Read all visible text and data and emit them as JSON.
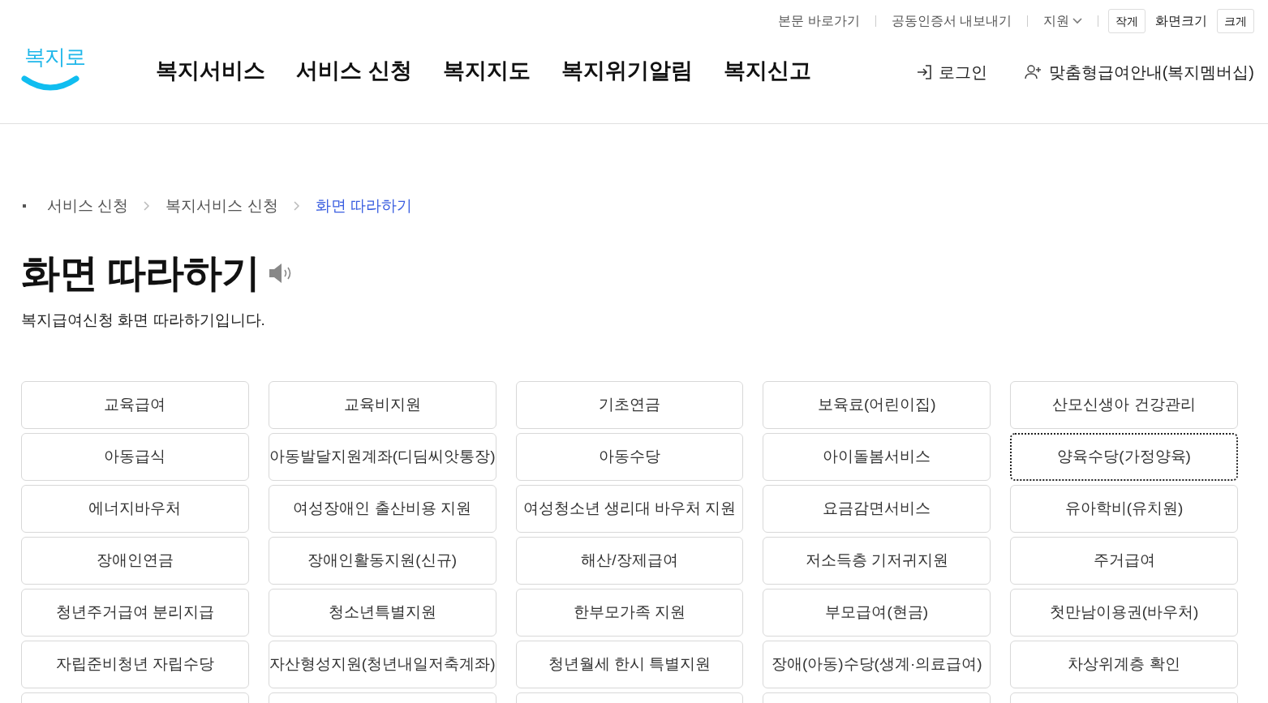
{
  "utility_links": [
    {
      "label": "본문 바로가기",
      "kind": "link"
    },
    {
      "label": "공동인증서 내보내기",
      "kind": "link"
    },
    {
      "label": "지원",
      "kind": "dropdown"
    }
  ],
  "font_size": {
    "smaller": "작게",
    "label": "화면크기",
    "larger": "크게"
  },
  "logo": {
    "text": "복지로"
  },
  "nav": [
    "복지서비스",
    "서비스 신청",
    "복지지도",
    "복지위기알림",
    "복지신고"
  ],
  "account": {
    "login": "로그인",
    "membership": "맞춤형급여안내(복지멤버십)"
  },
  "breadcrumb": [
    {
      "label": "서비스 신청",
      "selected": false
    },
    {
      "label": "복지서비스 신청",
      "selected": false
    },
    {
      "label": "화면 따라하기",
      "selected": true
    }
  ],
  "page": {
    "title": "화면 따라하기",
    "description": "복지급여신청 화면 따라하기입니다."
  },
  "services": [
    {
      "label": "교육급여",
      "focused": false
    },
    {
      "label": "교육비지원",
      "focused": false
    },
    {
      "label": "기초연금",
      "focused": false
    },
    {
      "label": "보육료(어린이집)",
      "focused": false
    },
    {
      "label": "산모신생아 건강관리",
      "focused": false
    },
    {
      "label": "아동급식",
      "focused": false
    },
    {
      "label": "아동발달지원계좌(디딤씨앗통장)",
      "focused": false
    },
    {
      "label": "아동수당",
      "focused": false
    },
    {
      "label": "아이돌봄서비스",
      "focused": false
    },
    {
      "label": "양육수당(가정양육)",
      "focused": true
    },
    {
      "label": "에너지바우처",
      "focused": false
    },
    {
      "label": "여성장애인 출산비용 지원",
      "focused": false
    },
    {
      "label": "여성청소년 생리대 바우처 지원",
      "focused": false
    },
    {
      "label": "요금감면서비스",
      "focused": false
    },
    {
      "label": "유아학비(유치원)",
      "focused": false
    },
    {
      "label": "장애인연금",
      "focused": false
    },
    {
      "label": "장애인활동지원(신규)",
      "focused": false
    },
    {
      "label": "해산/장제급여",
      "focused": false
    },
    {
      "label": "저소득층 기저귀지원",
      "focused": false
    },
    {
      "label": "주거급여",
      "focused": false
    },
    {
      "label": "청년주거급여 분리지급",
      "focused": false
    },
    {
      "label": "청소년특별지원",
      "focused": false
    },
    {
      "label": "한부모가족 지원",
      "focused": false
    },
    {
      "label": "부모급여(현금)",
      "focused": false
    },
    {
      "label": "첫만남이용권(바우처)",
      "focused": false
    },
    {
      "label": "자립준비청년 자립수당",
      "focused": false
    },
    {
      "label": "자산형성지원(청년내일저축계좌)",
      "focused": false
    },
    {
      "label": "청년월세 한시 특별지원",
      "focused": false
    },
    {
      "label": "장애(아동)수당(생계·의료급여)",
      "focused": false
    },
    {
      "label": "차상위계층 확인",
      "focused": false
    }
  ]
}
